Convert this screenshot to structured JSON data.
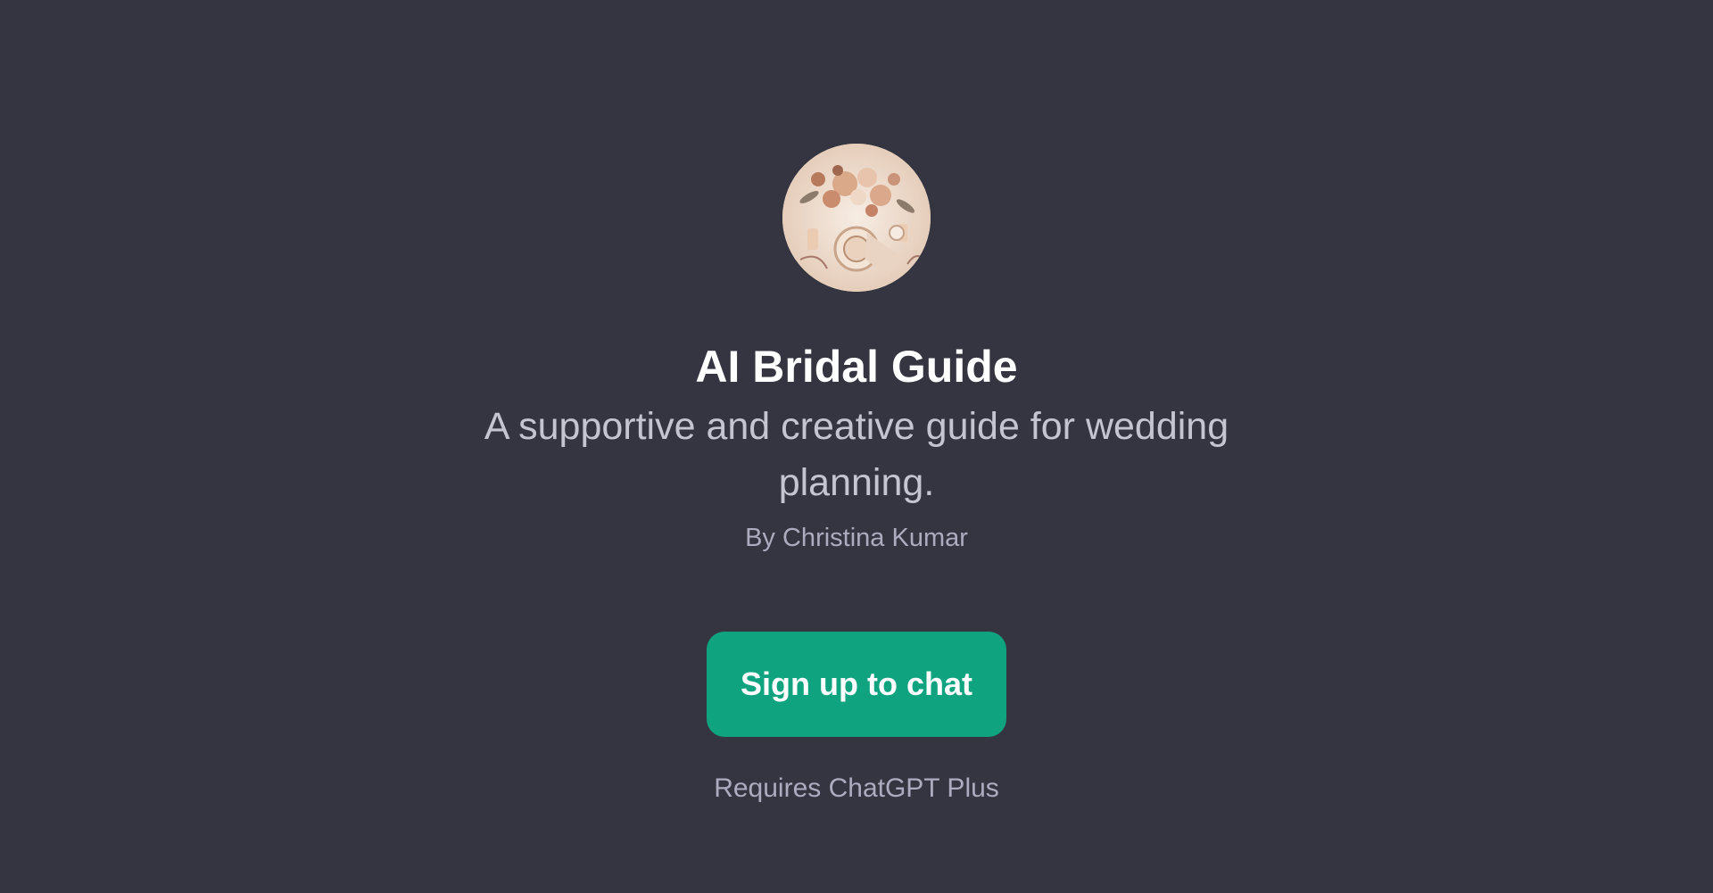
{
  "gpt": {
    "avatar_icon": "floral-table-setting-image",
    "title": "AI Bridal Guide",
    "description": "A supportive and creative guide for wedding planning.",
    "author": "By Christina Kumar"
  },
  "cta": {
    "signup_label": "Sign up to chat",
    "requirement": "Requires ChatGPT Plus"
  },
  "colors": {
    "background": "#343541",
    "title": "#ffffff",
    "description": "#c5c5d2",
    "muted": "#acacbe",
    "accent": "#10a37f"
  }
}
